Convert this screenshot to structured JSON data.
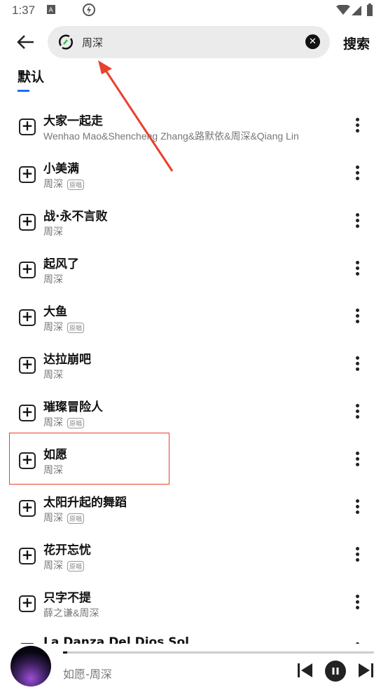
{
  "status": {
    "time": "1:37"
  },
  "search": {
    "query": "周深",
    "button": "搜索"
  },
  "tabs": [
    {
      "label": "默认",
      "active": true
    }
  ],
  "songs": [
    {
      "title": "大家一起走",
      "artist": "Wenhao Mao&Shencheng Zhang&路默依&周深&Qiang Lin",
      "badge": ""
    },
    {
      "title": "小美满",
      "artist": "周深",
      "badge": "原唱"
    },
    {
      "title": "战·永不言败",
      "artist": "周深",
      "badge": ""
    },
    {
      "title": "起风了",
      "artist": "周深",
      "badge": ""
    },
    {
      "title": "大鱼",
      "artist": "周深",
      "badge": "原唱"
    },
    {
      "title": "达拉崩吧",
      "artist": "周深",
      "badge": ""
    },
    {
      "title": "璀璨冒险人",
      "artist": "周深",
      "badge": "原唱"
    },
    {
      "title": "如愿",
      "artist": "周深",
      "badge": ""
    },
    {
      "title": "太阳升起的舞蹈",
      "artist": "周深",
      "badge": "原唱"
    },
    {
      "title": "花开忘忧",
      "artist": "周深",
      "badge": "原唱"
    },
    {
      "title": "只字不提",
      "artist": "薛之谦&周深",
      "badge": ""
    },
    {
      "title": "La Danza Del Dios Sol",
      "artist": "",
      "badge": ""
    }
  ],
  "player": {
    "now_playing": "如愿-周深",
    "progress": 0.01
  },
  "colors": {
    "accent": "#1a6ef5",
    "annotation": "#e8412c"
  }
}
